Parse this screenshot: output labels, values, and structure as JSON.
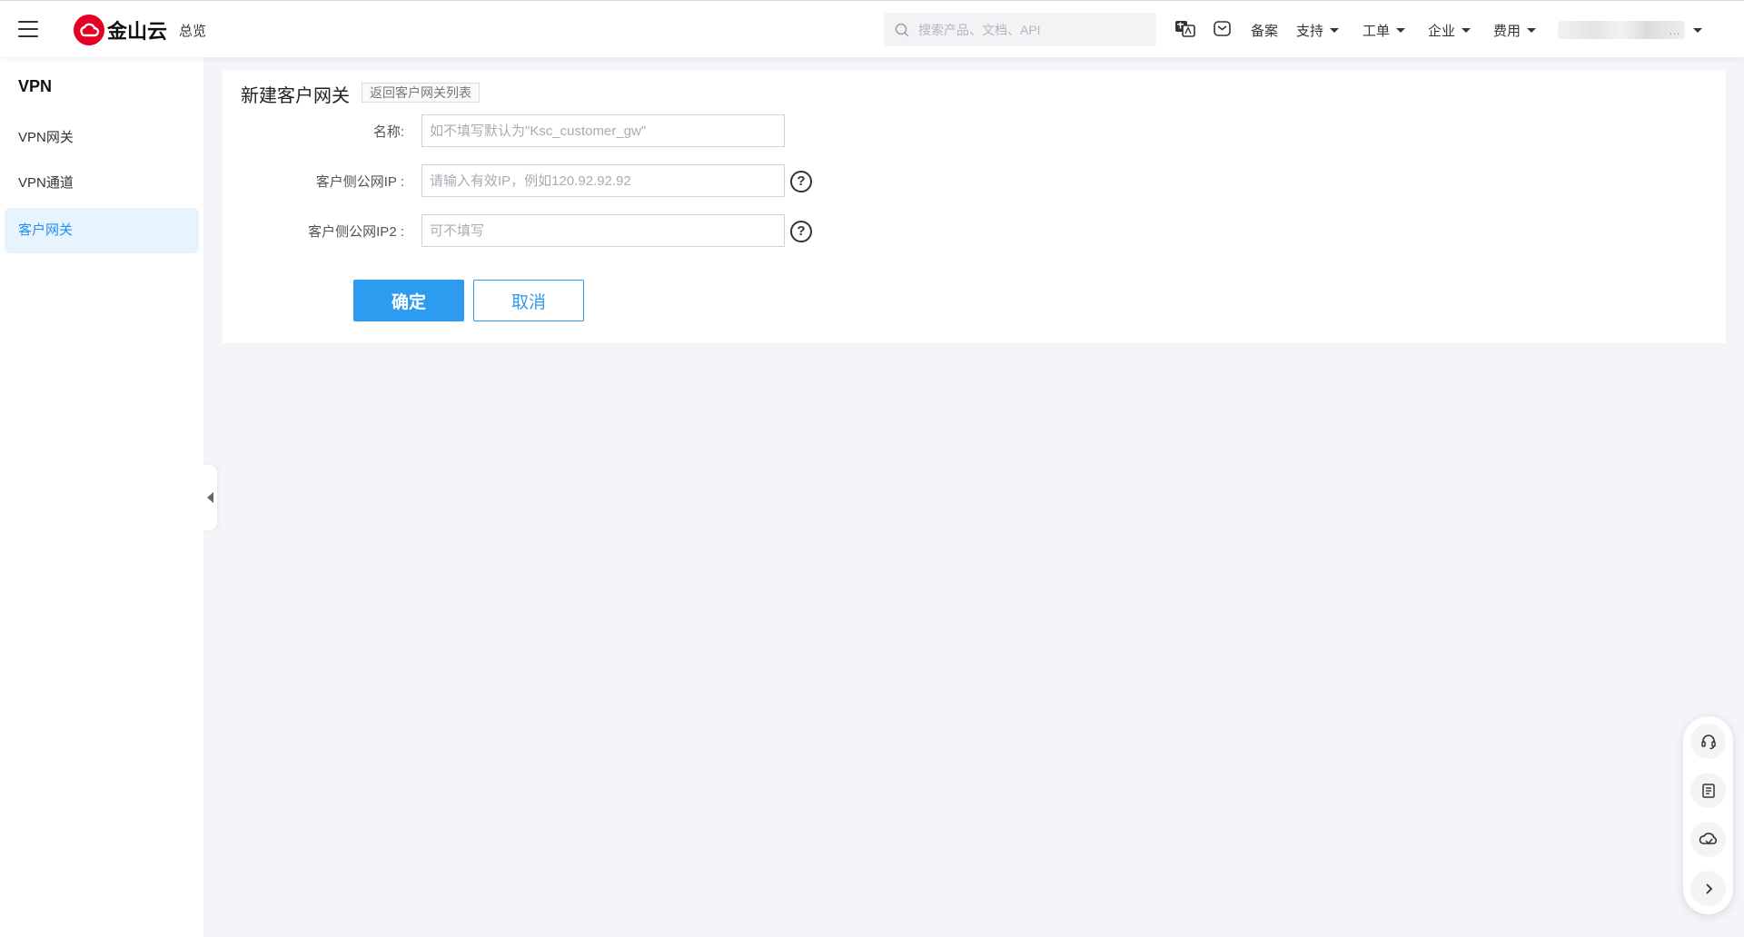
{
  "header": {
    "brand": "金山云",
    "overview_label": "总览",
    "search_placeholder": "搜索产品、文档、API",
    "nav": {
      "beian": "备案",
      "support": "支持",
      "ticket": "工单",
      "enterprise": "企业",
      "billing": "费用"
    },
    "account_name": "…"
  },
  "sidebar": {
    "title": "VPN",
    "items": [
      {
        "label": "VPN网关",
        "active": false
      },
      {
        "label": "VPN通道",
        "active": false
      },
      {
        "label": "客户网关",
        "active": true
      }
    ]
  },
  "form": {
    "title": "新建客户网关",
    "back_label": "返回客户网关列表",
    "fields": [
      {
        "label": "名称:",
        "value": "",
        "placeholder": "如不填写默认为\"Ksc_customer_gw\"",
        "help": false
      },
      {
        "label": "客户侧公网IP :",
        "value": "",
        "placeholder": "请输入有效IP，例如120.92.92.92",
        "help": true
      },
      {
        "label": "客户侧公网IP2 :",
        "value": "",
        "placeholder": "可不填写",
        "help": true
      }
    ],
    "help_glyph": "?",
    "confirm_label": "确定",
    "cancel_label": "取消"
  },
  "colors": {
    "brand_red": "#e60023",
    "primary_blue": "#2d9bf0",
    "active_bg": "#e8f4fd"
  },
  "float_tools": [
    "headset-icon",
    "document-icon",
    "cloud-icon",
    "chevron-right-icon"
  ]
}
